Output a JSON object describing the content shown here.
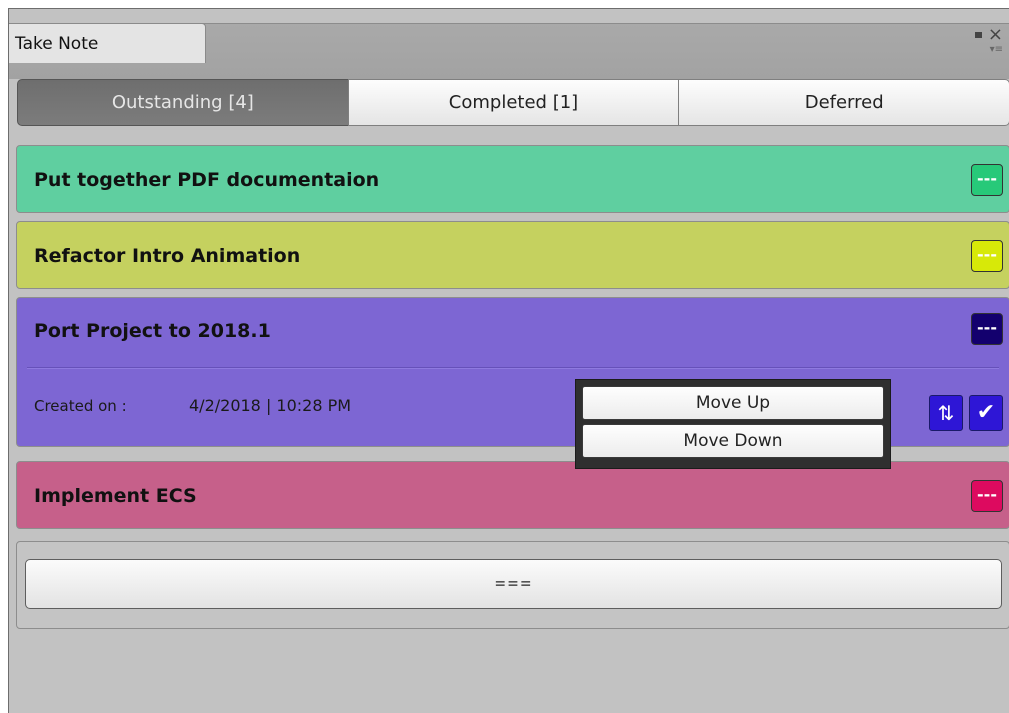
{
  "window": {
    "tab_label": "Take Note",
    "close_glyph": "×",
    "menu_glyph": "▾≡"
  },
  "tabs": [
    {
      "label": "Outstanding [4]",
      "active": true
    },
    {
      "label": "Completed [1]",
      "active": false
    },
    {
      "label": "Deferred",
      "active": false
    }
  ],
  "notes": [
    {
      "title": "Put together PDF documentaion",
      "color": "#5fcfa0",
      "button_color": "#27c979",
      "button_label": "---"
    },
    {
      "title": "Refactor Intro Animation",
      "color": "#c5d15f",
      "button_color": "#d7e908",
      "button_label": "---"
    },
    {
      "title": "Port Project to 2018.1",
      "color": "#7d66d3",
      "button_color": "#13006e",
      "button_label": "---",
      "created_label": "Created on :",
      "created_date": "4/2/2018 | 10:28 PM",
      "reorder_icon": "⇅",
      "complete_icon": "✔"
    },
    {
      "title": "Implement ECS",
      "color": "#c6608a",
      "button_color": "#dd0a5f",
      "button_label": "---"
    }
  ],
  "footer": {
    "add_label": "==="
  },
  "context_menu": {
    "items": [
      "Move Up",
      "Move Down"
    ]
  }
}
